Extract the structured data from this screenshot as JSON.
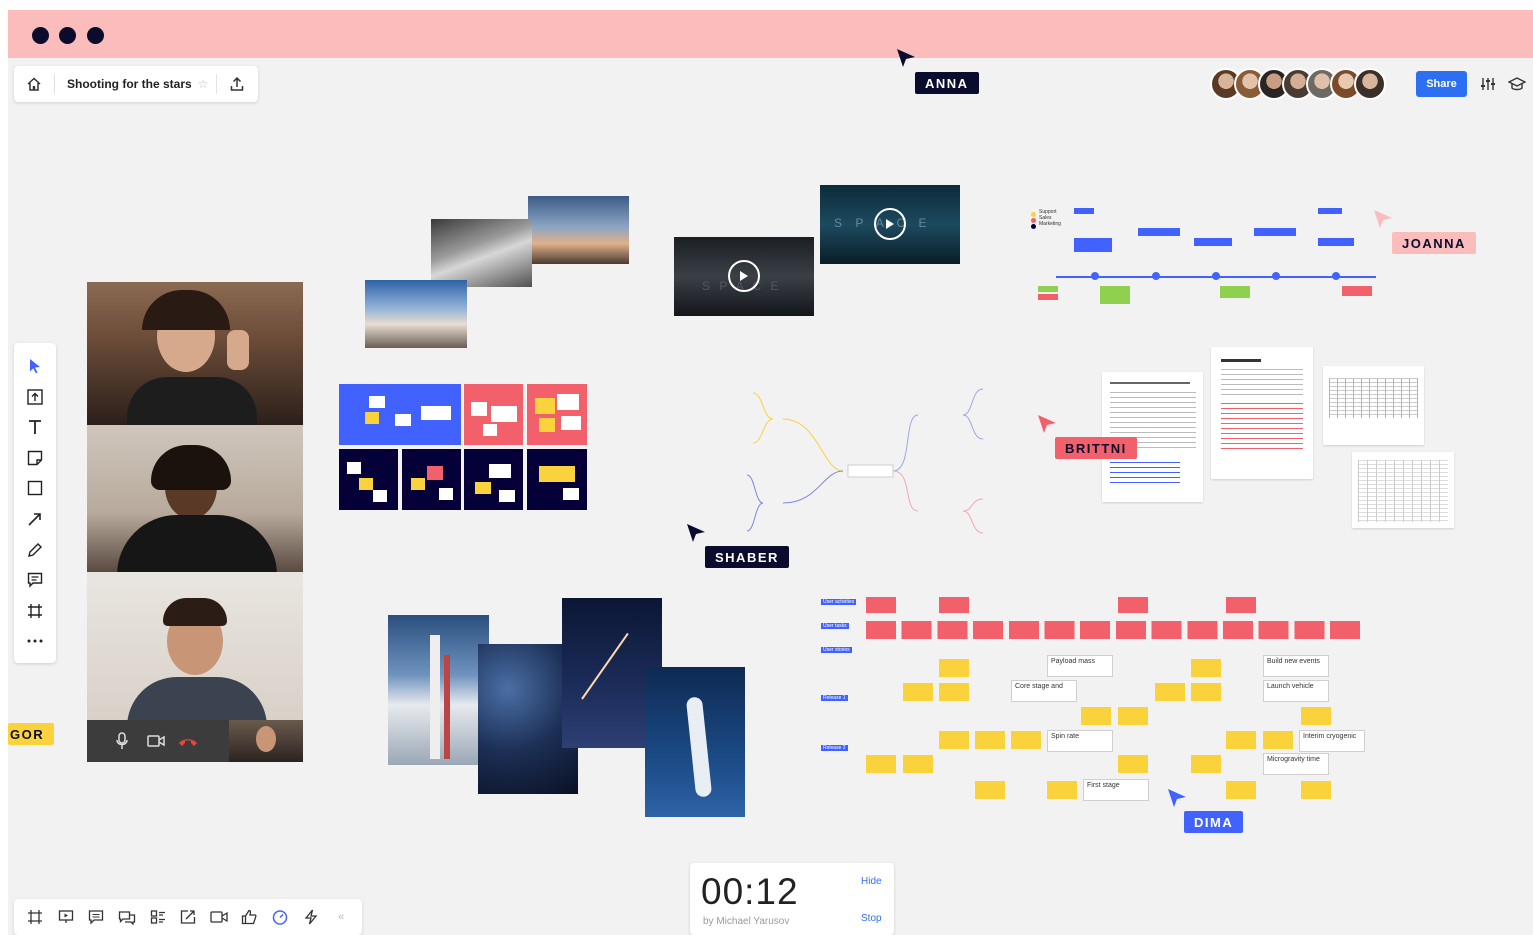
{
  "window": {
    "titlebar_color": "#fbbcbc",
    "canvas_color": "#f2f2f2"
  },
  "header": {
    "home_icon": "home-icon",
    "board_title": "Shooting for the stars",
    "star_icon": "star-icon",
    "export_icon": "upload-icon"
  },
  "top_right": {
    "share_label": "Share",
    "settings_icon": "sliders-icon",
    "learn_icon": "graduation-cap-icon",
    "avatar_count": 7
  },
  "cursors": [
    {
      "name": "ANNA",
      "color": "#0b0b2e"
    },
    {
      "name": "JOANNA",
      "color": "#fbbcbc"
    },
    {
      "name": "BRITTNI",
      "color": "#f2616b"
    },
    {
      "name": "SHABER",
      "color": "#0b0b2e"
    },
    {
      "name": "DIMA",
      "color": "#4262ff"
    },
    {
      "name": "GOR",
      "color": "#fad23c"
    }
  ],
  "left_toolbar": [
    {
      "icon": "select-arrow-icon"
    },
    {
      "icon": "upload-frame-icon"
    },
    {
      "icon": "text-icon"
    },
    {
      "icon": "sticky-note-icon"
    },
    {
      "icon": "shape-rectangle-icon"
    },
    {
      "icon": "connector-arrow-icon"
    },
    {
      "icon": "pen-icon"
    },
    {
      "icon": "comment-icon"
    },
    {
      "icon": "frame-icon"
    },
    {
      "icon": "more-icon"
    }
  ],
  "bottom_toolbar": [
    {
      "icon": "frames-icon"
    },
    {
      "icon": "presentation-icon"
    },
    {
      "icon": "comments-icon"
    },
    {
      "icon": "chat-icon"
    },
    {
      "icon": "card-list-icon"
    },
    {
      "icon": "screen-share-icon"
    },
    {
      "icon": "video-call-icon"
    },
    {
      "icon": "vote-icon"
    },
    {
      "icon": "timer-icon",
      "active": true
    },
    {
      "icon": "lightning-icon"
    },
    {
      "icon": "collapse-icon"
    }
  ],
  "timer": {
    "value": "00:12",
    "author": "by Michael Yarusov",
    "hide_label": "Hide",
    "stop_label": "Stop"
  },
  "video_call": {
    "participants": 3,
    "controls": [
      "mic-icon",
      "camera-icon",
      "hang-up-icon"
    ]
  },
  "story_map": {
    "row_labels": [
      "User activities",
      "User tasks",
      "User stories",
      "Release 1",
      "Release 2",
      "Release 3"
    ],
    "cards": [
      "Payload mass",
      "Build new events",
      "Core stage and",
      "Launch vehicle",
      "Spin rate",
      "Interim cryogenic",
      "Microgravity time",
      "First stage"
    ]
  },
  "slides": {
    "video_titles": [
      "S P A C E",
      "S P A C E"
    ]
  },
  "timeline": {
    "legend": [
      "Support",
      "Sales",
      "Marketing"
    ]
  }
}
